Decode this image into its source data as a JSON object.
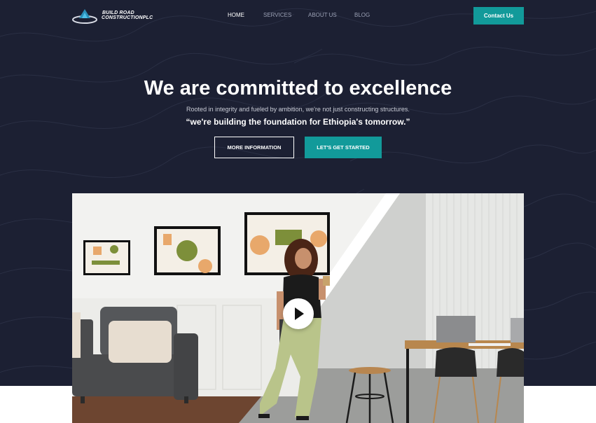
{
  "header": {
    "logo": {
      "line1": "BUILD ROAD",
      "line2": "CONSTRUCTION",
      "suffix": "PLC"
    },
    "nav": {
      "items": [
        {
          "label": "HOME",
          "active": true
        },
        {
          "label": "SERVICES",
          "active": false
        },
        {
          "label": "ABOUT US",
          "active": false
        },
        {
          "label": "BLOG",
          "active": false
        }
      ]
    },
    "contact_label": "Contact Us"
  },
  "hero": {
    "headline": "We are committed to excellence",
    "subline": "Rooted in integrity and fueled by ambition, we're not just constructing structures.",
    "quote": "“we're building the foundation for Ethiopia's tomorrow.”",
    "more_info_label": "MORE INFORMATION",
    "get_started_label": "LET'S GET STARTED"
  },
  "media": {
    "play_icon": "play-icon"
  },
  "colors": {
    "hero_bg": "#1c2033",
    "accent": "#129a9a",
    "nav_inactive": "#9aa0b4",
    "text_light": "#ffffff"
  }
}
